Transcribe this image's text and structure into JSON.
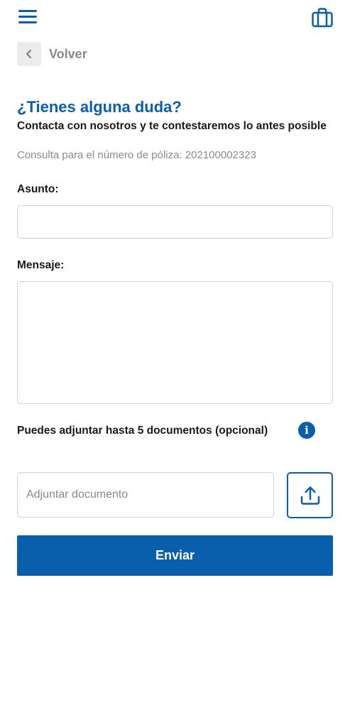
{
  "header": {
    "menu_icon": "hamburger-menu-icon",
    "briefcase_icon": "briefcase-icon"
  },
  "back": {
    "icon": "chevron-left-icon",
    "label": "Volver"
  },
  "form": {
    "title": "¿Tienes alguna duda?",
    "subtitle": "Contacta con nosotros y te contestaremos lo antes posible",
    "policy_prefix": "Consulta para el número de póliza: ",
    "policy_number": "202100002323",
    "subject_label": "Asunto:",
    "subject_value": "",
    "message_label": "Mensaje:",
    "message_value": "",
    "attach_info": "Puedes adjuntar hasta 5 documentos (opcional)",
    "info_icon": "info-icon",
    "attach_placeholder": "Adjuntar documento",
    "upload_icon": "upload-icon",
    "submit_label": "Enviar"
  },
  "colors": {
    "primary": "#0a5fad",
    "muted_text": "#8a8a8a",
    "border": "#cfd3d8"
  }
}
